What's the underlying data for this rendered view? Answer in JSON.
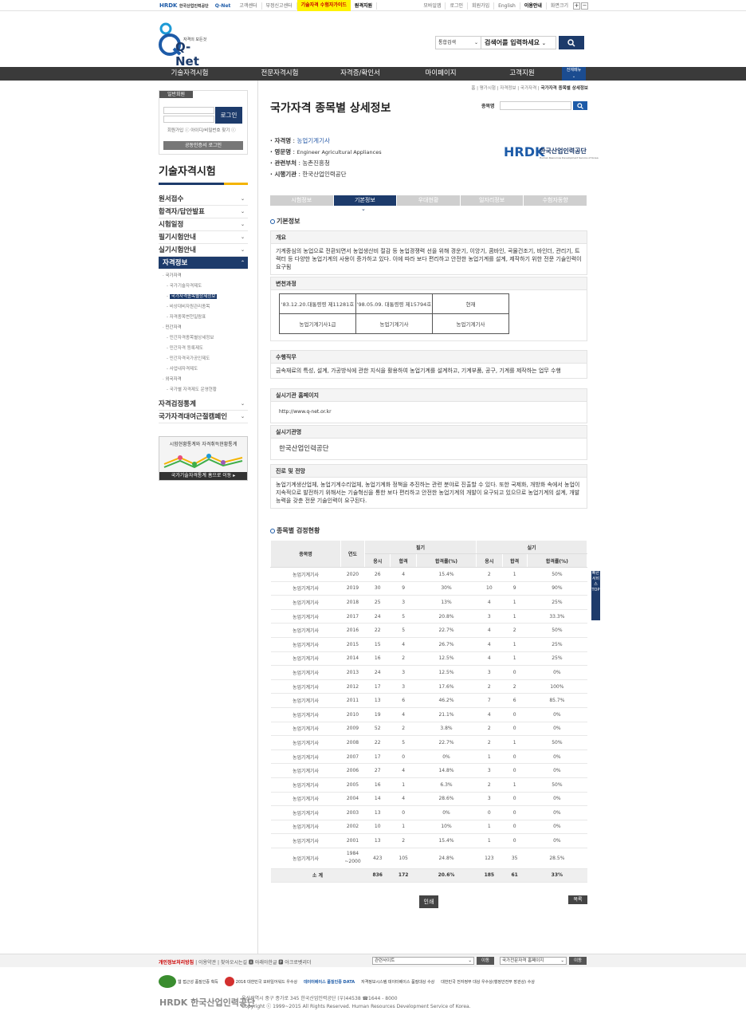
{
  "topbar": {
    "links": [
      "고객센터",
      "부정신고센터",
      "기술자격 수험자가이드",
      "원격지원"
    ],
    "right_links": [
      "모바일앱",
      "로그인",
      "회원가입",
      "English",
      "이용안내",
      "화면크기"
    ]
  },
  "logo": {
    "small": "자격의 모든것",
    "main": "Q-Net"
  },
  "search": {
    "select": "통합검색",
    "placeholder": "검색어를 입력하세요"
  },
  "gnb": [
    "기술자격시험",
    "전문자격시험",
    "자격증/확인서",
    "마이페이지",
    "고객지원"
  ],
  "allmenu": "전체메뉴",
  "sidebar": {
    "tag": "일반회원",
    "login": "로그인",
    "links": "회원가입 ⓘ  아이디/비밀번호 찾기 ⓘ",
    "cert": "공동인증서 로그인",
    "title": "기술자격시험",
    "menu": [
      "원서접수",
      "합격자/답안발표",
      "시험일정",
      "필기시험안내",
      "실기시험안내"
    ],
    "active": "자격정보",
    "sub": [
      "국가자격",
      "국가기술자격제도",
      "국가자격종목별상세정보",
      "비상대비자원관리종목",
      "자격종목변천일람표",
      "민간자격",
      "민간자격종목별상세정보",
      "민간자격 등록제도",
      "민간자격국가공인제도",
      "사업내자격제도",
      "외국자격",
      "국가별 자격제도 운영현황"
    ],
    "menu2": [
      "자격검정통계",
      "국가자격대여근절캠페인"
    ],
    "banner_title": "시험현황통계와 자격취득현황통계",
    "banner_btn": "국가기술자격통계 홈으로 이동 ▸"
  },
  "crumb": {
    "path": "홈 | 평가시험 | 자격정보 | 국가자격 |",
    "current": "국가자격 종목별 상세정보"
  },
  "page_title": "국가자격 종목별 상세정보",
  "jongmok": "종목명",
  "info": {
    "k1": "· 자격명",
    "v1": "농업기계기사",
    "k2": "· 영문명",
    "v2": "Engineer Agricultural Appliances",
    "k3": "· 관련부처",
    "v3": "농촌진흥청",
    "k4": "· 시행기관",
    "v4": "한국산업인력공단"
  },
  "hrdk": {
    "name": "한국산업인력공단",
    "sub": "Human Resources Development Service of Korea"
  },
  "tabs": [
    "시험정보",
    "기본정보",
    "우대현황",
    "일자리정보",
    "수험자동향"
  ],
  "basic_title": "기본정보",
  "sec": {
    "overview_h": "개요",
    "overview": "기계중심의 농업으로 전환되면서 농업생산비 절감 등 농업경쟁력 선을 위해 경운기, 이앙기, 콤바인, 곡물건조기, 바인더, 관리기, 트랙터 등 다양한 농업기계의 사용이 증가하고 있다. 이에 따라 보다 편리하고 안전한 농업기계를 설계, 제작하기 위한 전문 기술인력이 요구됨",
    "history_h": "변천과정",
    "history": [
      [
        "'83.12.20.대통령령 제11281호",
        "'98.05.09. 대통령령 제15794호",
        "현재"
      ],
      [
        "농업기계기사1급",
        "농업기계기사",
        "농업기계기사"
      ]
    ],
    "duty_h": "수행직무",
    "duty": "금속재료의 특성, 설계, 가공방식에 관한 지식을 활용하여 농업기계를 설계하고, 기계부품, 공구, 기계를 제작하는 업무 수행",
    "home_h": "실시기관 홈페이지",
    "home": "http://www.q-net.or.kr",
    "org_h": "실시기관명",
    "org": "한국산업인력공단",
    "career_h": "진로 및 전망",
    "career": "농업기계생산업체, 농업기계수리업체, 농업기계화 정책을 추진하는 관련 분야로 진출할 수 있다. 또한 국제화, 개방화 속에서 농업이 지속적으로 발전하기 위해서는 기술혁신을 통한 보다 편리하고 안전한 농업기계의 개발이 요구되고 있으므로 농업기계의 설계, 개발능력을 갖춘 전문 기술인력이 요구된다."
  },
  "stat_title": "종목별 검정현황",
  "stat_head": {
    "name": "종목명",
    "year": "연도",
    "written": "필기",
    "practical": "실기",
    "apply": "응시",
    "pass": "합격",
    "rate": "합격률(%)"
  },
  "stat_rows": [
    [
      "농업기계기사",
      "2020",
      "26",
      "4",
      "15.4%",
      "2",
      "1",
      "50%"
    ],
    [
      "농업기계기사",
      "2019",
      "30",
      "9",
      "30%",
      "10",
      "9",
      "90%"
    ],
    [
      "농업기계기사",
      "2018",
      "25",
      "3",
      "13%",
      "4",
      "1",
      "25%"
    ],
    [
      "농업기계기사",
      "2017",
      "24",
      "5",
      "20.8%",
      "3",
      "1",
      "33.3%"
    ],
    [
      "농업기계기사",
      "2016",
      "22",
      "5",
      "22.7%",
      "4",
      "2",
      "50%"
    ],
    [
      "농업기계기사",
      "2015",
      "15",
      "4",
      "26.7%",
      "4",
      "1",
      "25%"
    ],
    [
      "농업기계기사",
      "2014",
      "16",
      "2",
      "12.5%",
      "4",
      "1",
      "25%"
    ],
    [
      "농업기계기사",
      "2013",
      "24",
      "3",
      "12.5%",
      "3",
      "0",
      "0%"
    ],
    [
      "농업기계기사",
      "2012",
      "17",
      "3",
      "17.6%",
      "2",
      "2",
      "100%"
    ],
    [
      "농업기계기사",
      "2011",
      "13",
      "6",
      "46.2%",
      "7",
      "6",
      "85.7%"
    ],
    [
      "농업기계기사",
      "2010",
      "19",
      "4",
      "21.1%",
      "4",
      "0",
      "0%"
    ],
    [
      "농업기계기사",
      "2009",
      "52",
      "2",
      "3.8%",
      "2",
      "0",
      "0%"
    ],
    [
      "농업기계기사",
      "2008",
      "22",
      "5",
      "22.7%",
      "2",
      "1",
      "50%"
    ],
    [
      "농업기계기사",
      "2007",
      "17",
      "0",
      "0%",
      "1",
      "0",
      "0%"
    ],
    [
      "농업기계기사",
      "2006",
      "27",
      "4",
      "14.8%",
      "3",
      "0",
      "0%"
    ],
    [
      "농업기계기사",
      "2005",
      "16",
      "1",
      "6.3%",
      "2",
      "1",
      "50%"
    ],
    [
      "농업기계기사",
      "2004",
      "14",
      "4",
      "28.6%",
      "3",
      "0",
      "0%"
    ],
    [
      "농업기계기사",
      "2003",
      "13",
      "0",
      "0%",
      "0",
      "0",
      "0%"
    ],
    [
      "농업기계기사",
      "2002",
      "10",
      "1",
      "10%",
      "1",
      "0",
      "0%"
    ],
    [
      "농업기계기사",
      "2001",
      "13",
      "2",
      "15.4%",
      "1",
      "0",
      "0%"
    ]
  ],
  "stat_last": {
    "name": "농업기계기사",
    "year1": "1984",
    "year2": "~2000",
    "a": "423",
    "b": "105",
    "c": "24.8%",
    "d": "123",
    "e": "35",
    "f": "28.5%"
  },
  "stat_total": {
    "label": "소 계",
    "a": "836",
    "b": "172",
    "c": "20.6%",
    "d": "185",
    "e": "61",
    "f": "33%"
  },
  "print": "인쇄",
  "list": "목록",
  "floater": "빠른서비스 TOP",
  "footer": {
    "privacy": "개인정보처리방침",
    "links": " | 이용약관 | 찾아오시는길  🅰 아래아한글  🅿 아크로벳리더",
    "sel1": "관련사이트",
    "sel2": "국가전문자격 홈페이지",
    "go": "이동",
    "awards": [
      "웹 접근성 품질인증 획득",
      "2016 대한민국 모바일어워드 우수상",
      "데이터베이스 품질인증 DATA",
      "자격정보시스템 데이터베이스 품질대상 수상",
      "대한민국 전자정부 대상 우수상(행정안전부 장관상) 수상"
    ],
    "addr": "울산광역시 중구 종가로 345 한국산업인력공단 (우)44538 ☎1644 - 8000",
    "copy": "Copyright ⓒ 1999~2015 All Rights Reserved. Human Resources Development Service of Korea.",
    "logo": "HRDK 한국산업인력공단"
  }
}
